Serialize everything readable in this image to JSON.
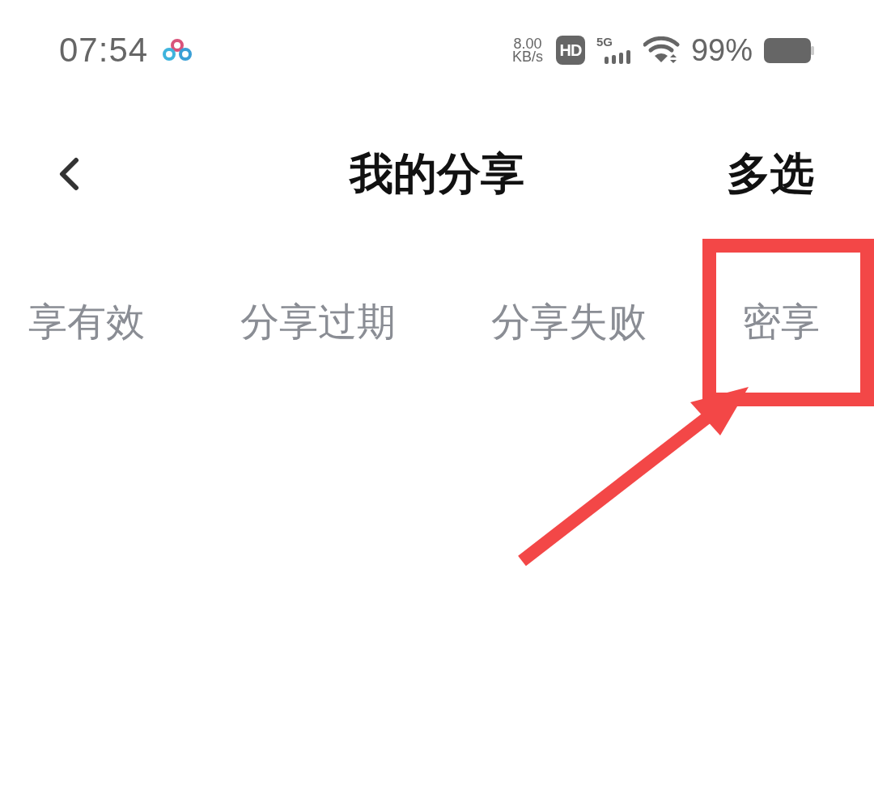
{
  "status_bar": {
    "time": "07:54",
    "speed_value": "8.00",
    "speed_unit": "KB/s",
    "hd_badge": "HD",
    "network_type": "5G",
    "battery_percent": "99%"
  },
  "nav_bar": {
    "title": "我的分享",
    "action": "多选"
  },
  "tabs": [
    {
      "label": "享有效",
      "selected": false
    },
    {
      "label": "分享过期",
      "selected": false
    },
    {
      "label": "分享失败",
      "selected": false
    },
    {
      "label": "密享",
      "selected": false
    }
  ]
}
